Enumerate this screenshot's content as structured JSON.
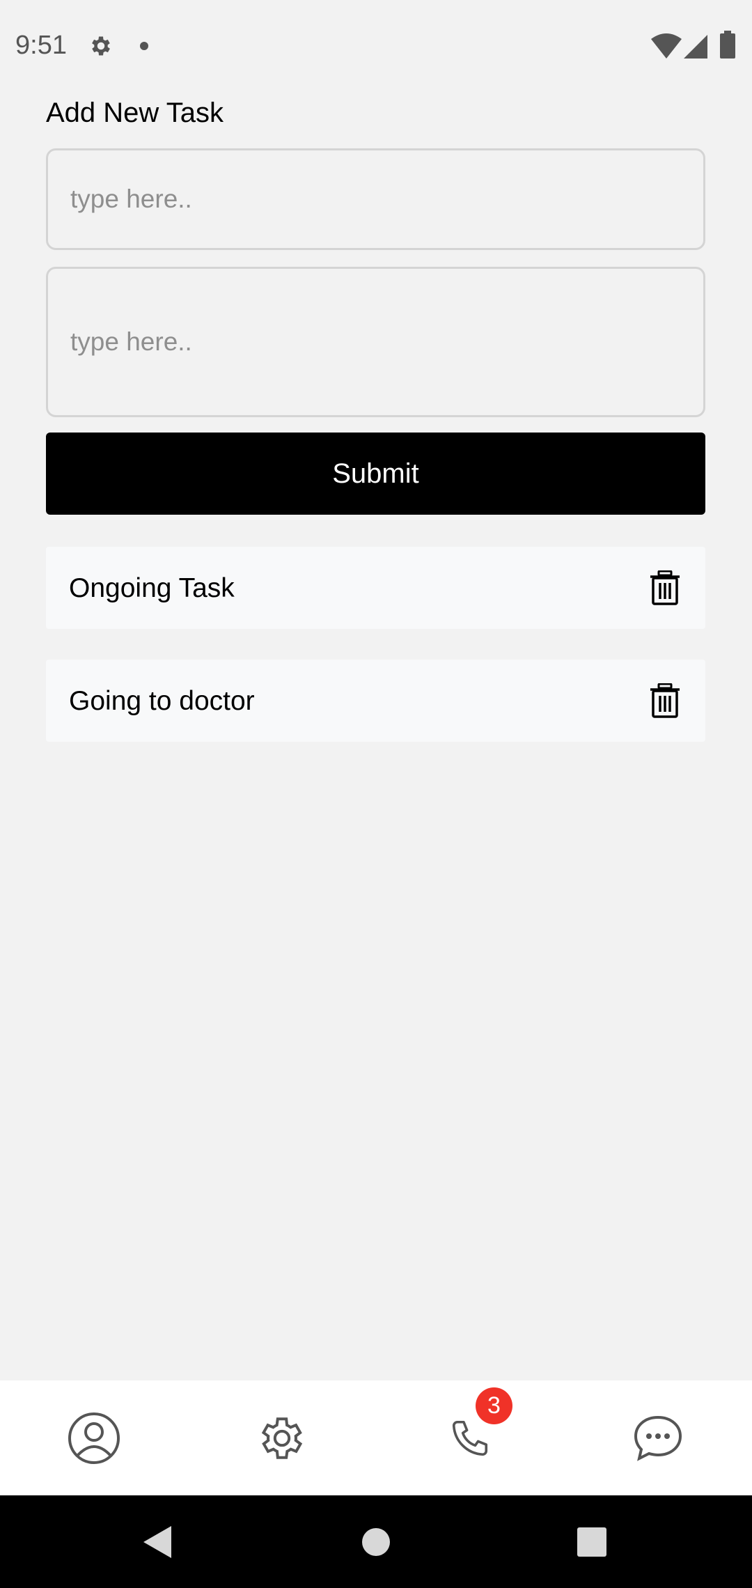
{
  "status_bar": {
    "time": "9:51",
    "left_icons": [
      "gear-icon",
      "dot-icon"
    ],
    "right_icons": [
      "wifi-icon",
      "signal-icon",
      "battery-icon"
    ]
  },
  "form": {
    "title": "Add New Task",
    "input1_placeholder": "type here..",
    "input2_placeholder": "type here..",
    "submit_label": "Submit"
  },
  "tasks": [
    {
      "title": "Ongoing Task",
      "icon": "trash-icon"
    },
    {
      "title": "Going to doctor",
      "icon": "trash-icon"
    }
  ],
  "bottom_nav": {
    "items": [
      {
        "icon": "profile-icon"
      },
      {
        "icon": "settings-icon"
      },
      {
        "icon": "phone-icon",
        "badge": "3"
      },
      {
        "icon": "chat-icon"
      }
    ],
    "badge_color": "#f03228"
  },
  "colors": {
    "background": "#f2f2f2",
    "button": "#000000",
    "card": "#f8f9fa"
  }
}
